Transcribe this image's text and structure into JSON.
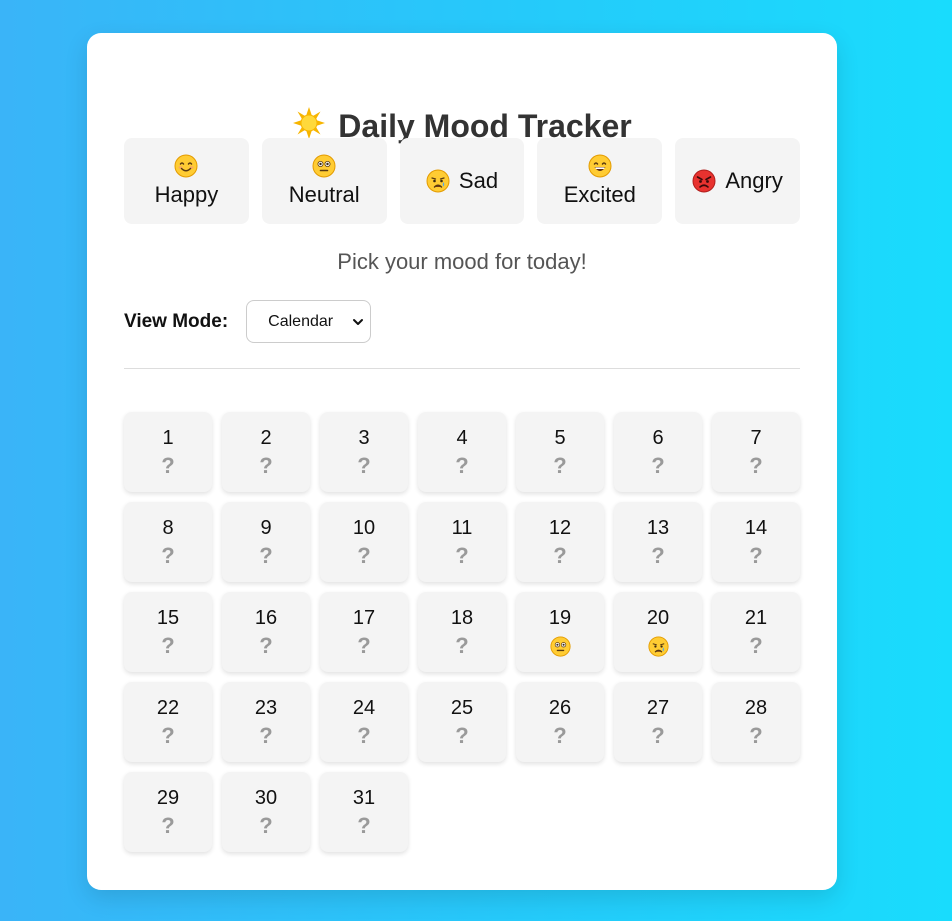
{
  "app": {
    "title": "Daily Mood Tracker",
    "title_icon": "sun-emoji",
    "prompt": "Pick your mood for today!"
  },
  "moods": [
    {
      "key": "happy",
      "label": "Happy",
      "icon": "smiling-face-icon",
      "layout": "stacked"
    },
    {
      "key": "neutral",
      "label": "Neutral",
      "icon": "neutral-face-icon",
      "layout": "stacked"
    },
    {
      "key": "sad",
      "label": "Sad",
      "icon": "crying-face-icon",
      "layout": "inline"
    },
    {
      "key": "excited",
      "label": "Excited",
      "icon": "grinning-face-icon",
      "layout": "stacked"
    },
    {
      "key": "angry",
      "label": "Angry",
      "icon": "angry-face-icon",
      "layout": "inline"
    }
  ],
  "view_mode": {
    "label": "View Mode:",
    "selected": "Calendar"
  },
  "calendar": {
    "empty_symbol": "?",
    "days": [
      {
        "day": "1",
        "mood": null
      },
      {
        "day": "2",
        "mood": null
      },
      {
        "day": "3",
        "mood": null
      },
      {
        "day": "4",
        "mood": null
      },
      {
        "day": "5",
        "mood": null
      },
      {
        "day": "6",
        "mood": null
      },
      {
        "day": "7",
        "mood": null
      },
      {
        "day": "8",
        "mood": null
      },
      {
        "day": "9",
        "mood": null
      },
      {
        "day": "10",
        "mood": null
      },
      {
        "day": "11",
        "mood": null
      },
      {
        "day": "12",
        "mood": null
      },
      {
        "day": "13",
        "mood": null
      },
      {
        "day": "14",
        "mood": null
      },
      {
        "day": "15",
        "mood": null
      },
      {
        "day": "16",
        "mood": null
      },
      {
        "day": "17",
        "mood": null
      },
      {
        "day": "18",
        "mood": null
      },
      {
        "day": "19",
        "mood": "neutral"
      },
      {
        "day": "20",
        "mood": "sad"
      },
      {
        "day": "21",
        "mood": null
      },
      {
        "day": "22",
        "mood": null
      },
      {
        "day": "23",
        "mood": null
      },
      {
        "day": "24",
        "mood": null
      },
      {
        "day": "25",
        "mood": null
      },
      {
        "day": "26",
        "mood": null
      },
      {
        "day": "27",
        "mood": null
      },
      {
        "day": "28",
        "mood": null
      },
      {
        "day": "29",
        "mood": null
      },
      {
        "day": "30",
        "mood": null
      },
      {
        "day": "31",
        "mood": null
      }
    ]
  },
  "colors": {
    "background_start": "#3ab4f8",
    "background_end": "#19dcfd",
    "card": "#ffffff",
    "tile": "#f4f4f4",
    "empty_symbol": "#9a9a9a"
  }
}
